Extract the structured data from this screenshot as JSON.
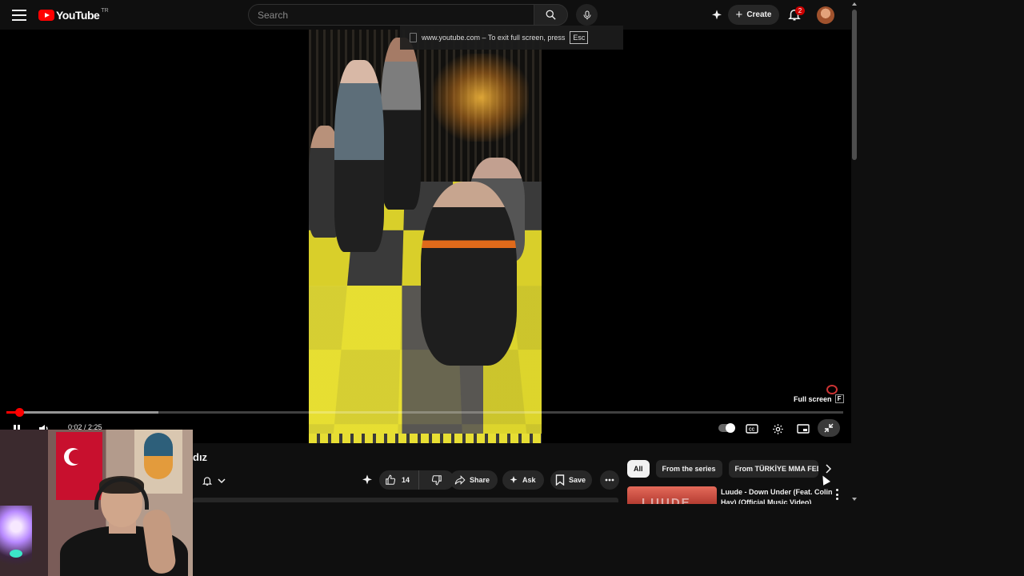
{
  "masthead": {
    "logo_text": "YouTube",
    "country_code": "TR",
    "search_placeholder": "Search",
    "create_label": "Create",
    "notification_count": "2"
  },
  "player": {
    "fullscreen_tip_text": "www.youtube.com – To exit full screen, press",
    "fullscreen_tip_key": "Esc",
    "fullscreen_label": "Full screen",
    "fullscreen_key": "F",
    "current_time": "0:02",
    "duration": "2:25",
    "time_display": "0:02 / 2:25",
    "played_fraction": 0.015,
    "buffered_fraction": 0.182,
    "autoplay_on": true
  },
  "video": {
    "title_fragment": "dız",
    "like_count": "14",
    "share_label": "Share",
    "ask_label": "Ask",
    "save_label": "Save"
  },
  "sidebar": {
    "chips": [
      "All",
      "From the series",
      "From TÜRKİYE MMA FED"
    ],
    "active_chip": "All",
    "recommendation": {
      "title": "Luude - Down Under (Feat. Colin Hay) (Official Music Video)",
      "thumbnail_text": "LUUDE"
    }
  },
  "colors": {
    "brand_red": "#ff0000",
    "background": "#0f0f0f",
    "pill_bg": "#272727",
    "badge_red": "#cc0000"
  },
  "icons": [
    "menu-icon",
    "youtube-logo-icon",
    "search-icon",
    "mic-icon",
    "ask-sparkle-icon",
    "plus-icon",
    "bell-icon",
    "pause-icon",
    "volume-icon",
    "captions-icon",
    "settings-icon",
    "theater-icon",
    "exit-fullscreen-icon",
    "like-icon",
    "dislike-icon",
    "share-icon",
    "save-icon",
    "more-icon",
    "chevron-right-icon",
    "chevron-down-icon"
  ]
}
